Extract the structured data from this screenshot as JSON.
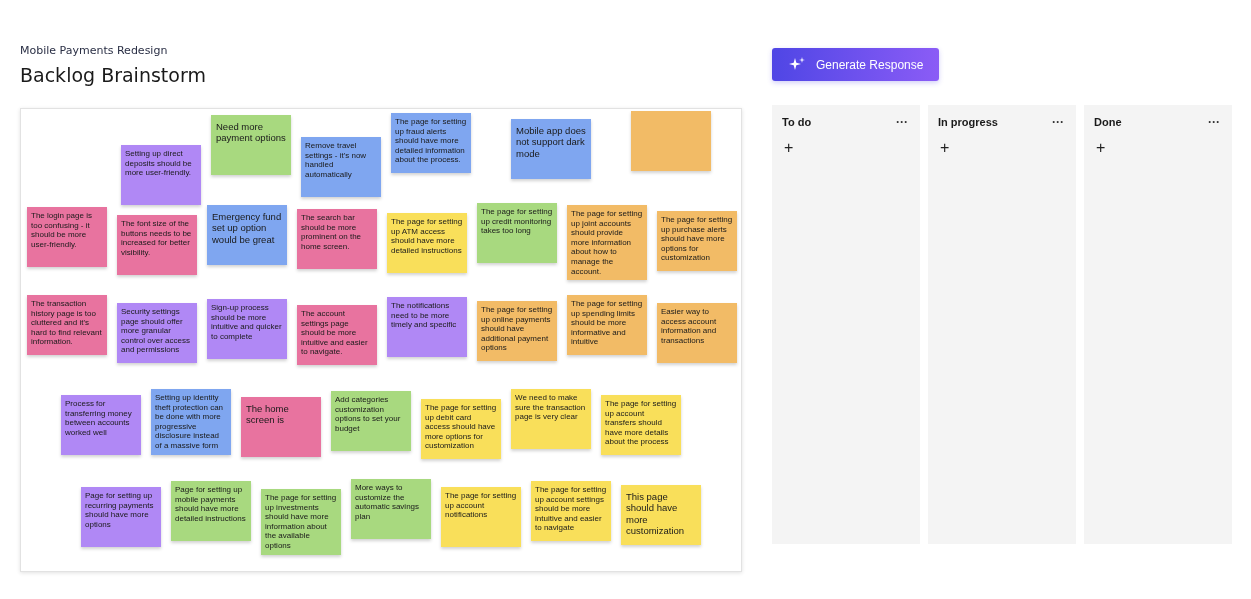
{
  "header": {
    "project": "Mobile Payments Redesign",
    "title": "Backlog Brainstorm"
  },
  "generate_button": {
    "label": "Generate Response"
  },
  "canvas": {
    "notes": [
      {
        "text": "Setting up direct deposits should be more user-friendly.",
        "color": "#b088f5"
      },
      {
        "text": "Need more payment options",
        "color": "#a8d97f"
      },
      {
        "text": "Remove travel settings - it's now handled automatically",
        "color": "#7fa6f0"
      },
      {
        "text": "The page for setting up fraud alerts should have more detailed information about the process.",
        "color": "#7fa6f0"
      },
      {
        "text": "Mobile app does not support dark mode",
        "color": "#7fa6f0"
      },
      {
        "color": "#f2bb66"
      },
      {
        "text": "The login page is too confusing - it should be more user-friendly.",
        "color": "#e8739f"
      },
      {
        "text": "The font size of the buttons needs to be increased for better visibility.",
        "color": "#e8739f"
      },
      {
        "text": "Emergency fund set up option would be great",
        "color": "#7fa6f0"
      },
      {
        "text": "The search bar should be more prominent on the home screen.",
        "color": "#e8739f"
      },
      {
        "text": "The page for setting up ATM access should have more detailed instructions",
        "color": "#f9df5a"
      },
      {
        "text": "The page for setting up credit monitoring takes too long",
        "color": "#a8d97f"
      },
      {
        "text": "The page for setting up joint accounts should provide more information about how to manage the account.",
        "color": "#f2bb66"
      },
      {
        "text": "The page for setting up purchase alerts should have more options for customization",
        "color": "#f2bb66"
      },
      {
        "text": "The transaction history page is too cluttered and it's hard to find relevant information.",
        "color": "#e8739f"
      },
      {
        "text": "Security settings page should offer more granular control over access and permissions",
        "color": "#b088f5"
      },
      {
        "text": "Sign-up process should be more intuitive and quicker to complete",
        "color": "#b088f5"
      },
      {
        "text": "The account settings page should be more intuitive and easier to navigate.",
        "color": "#e8739f"
      },
      {
        "text": "The notifications need to be more timely and specific",
        "color": "#b088f5"
      },
      {
        "text": "The page for setting up online payments should have additional payment options",
        "color": "#f2bb66"
      },
      {
        "text": "The page for setting up spending limits should be more informative and intuitive",
        "color": "#f2bb66"
      },
      {
        "text": "Easier way to access account information and transactions",
        "color": "#f2bb66"
      },
      {
        "text": "Process for transferring money between accounts worked well",
        "color": "#b088f5"
      },
      {
        "text": "Setting up identity theft protection can be done with more progressive disclosure instead of a massive form",
        "color": "#7fa6f0"
      },
      {
        "text": "The home screen is",
        "color": "#e8739f"
      },
      {
        "text": "Add categories customization options to set your budget",
        "color": "#a8d97f"
      },
      {
        "text": "The page for setting up debit card access should have more options for customization",
        "color": "#f9df5a"
      },
      {
        "text": "We need to make sure the transaction page is very clear",
        "color": "#f9df5a"
      },
      {
        "text": "The page for setting up account transfers should have more details about the process",
        "color": "#f9df5a"
      },
      {
        "text": "Page for setting up recurring payments should have more options",
        "color": "#b088f5"
      },
      {
        "text": "Page for setting up mobile payments should have more detailed instructions",
        "color": "#a8d97f"
      },
      {
        "text": "The page for setting up investments should have more information about the available options",
        "color": "#a8d97f"
      },
      {
        "text": "More ways to customize the automatic savings plan",
        "color": "#a8d97f"
      },
      {
        "text": "The page for setting up account notifications",
        "color": "#f9df5a"
      },
      {
        "text": "The page for setting up account settings should be more intuitive and easier to navigate",
        "color": "#f9df5a"
      },
      {
        "text": "This page should have more customization",
        "color": "#f9df5a"
      }
    ]
  },
  "board": {
    "columns": [
      {
        "title": "To do",
        "menu": "···",
        "add": "+"
      },
      {
        "title": "In progress",
        "menu": "···",
        "add": "+"
      },
      {
        "title": "Done",
        "menu": "···",
        "add": "+"
      }
    ]
  }
}
